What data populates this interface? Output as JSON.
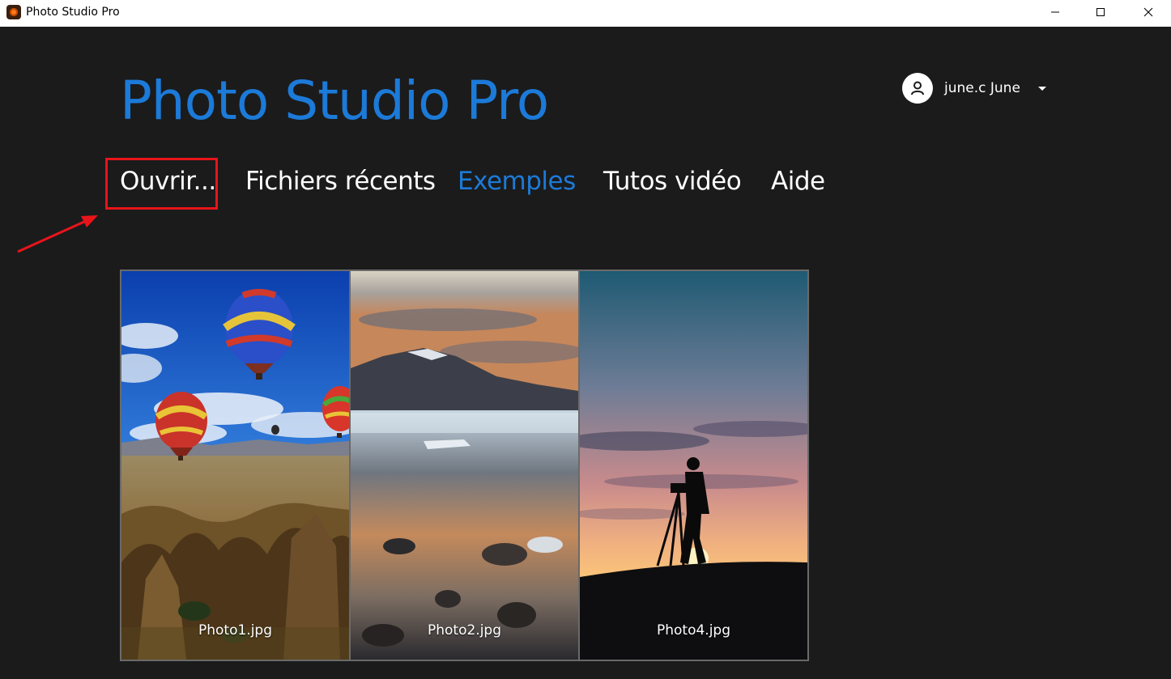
{
  "window": {
    "title": "Photo Studio Pro",
    "controls": [
      "minimize-icon",
      "maximize-icon",
      "close-icon"
    ]
  },
  "header": {
    "app_title": "Photo Studio Pro",
    "user_name": "june.c June"
  },
  "nav": {
    "items": [
      {
        "label": "Ouvrir..."
      },
      {
        "label": "Fichiers récents"
      },
      {
        "label": "Exemples",
        "active": true
      },
      {
        "label": "Tutos vidéo"
      },
      {
        "label": "Aide"
      }
    ]
  },
  "gallery": {
    "items": [
      {
        "label": "Photo1.jpg"
      },
      {
        "label": "Photo2.jpg"
      },
      {
        "label": "Photo4.jpg"
      }
    ]
  },
  "colors": {
    "background": "#1b1b1b",
    "accent": "#1c7ad8",
    "highlight": "#e8141a"
  }
}
